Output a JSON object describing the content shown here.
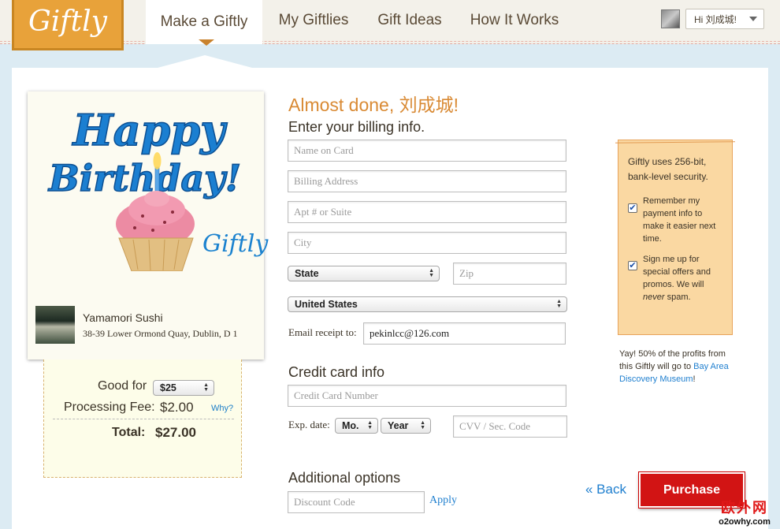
{
  "header": {
    "logo_text": "Giftly",
    "tabs": [
      {
        "label": "Make a Giftly"
      },
      {
        "label": "My Giftlies"
      },
      {
        "label": "Gift Ideas"
      },
      {
        "label": "How It Works"
      }
    ],
    "user_greeting": "Hi 刘成城!"
  },
  "card": {
    "art_text_line1": "Happy",
    "art_text_line2": "Birthday!",
    "brand": "Giftly",
    "merchant_name": "Yamamori Sushi",
    "merchant_address": "38-39 Lower Ormond Quay, Dublin, D 1"
  },
  "pricing": {
    "good_for_label": "Good for",
    "good_for_value": "$25",
    "fee_label": "Processing Fee:",
    "fee_value": "$2.00",
    "why_link": "Why?",
    "total_label": "Total:",
    "total_value": "$27.00"
  },
  "form": {
    "title": "Almost done, 刘成城!",
    "billing_heading": "Enter your billing info.",
    "name_on_card_placeholder": "Name on Card",
    "billing_address_placeholder": "Billing Address",
    "apt_placeholder": "Apt # or Suite",
    "city_placeholder": "City",
    "state_value": "State",
    "zip_placeholder": "Zip",
    "country_value": "United States",
    "email_label": "Email receipt to:",
    "email_value": "pekinlcc@126.com",
    "credit_heading": "Credit card info",
    "card_number_placeholder": "Credit Card Number",
    "exp_label": "Exp. date:",
    "month_value": "Mo.",
    "year_value": "Year",
    "cvv_placeholder": "CVV / Sec. Code",
    "additional_heading": "Additional options",
    "discount_placeholder": "Discount Code",
    "apply_label": "Apply"
  },
  "security": {
    "text": "Giftly uses 256-bit, bank-level security.",
    "remember_label": "Remember my payment info to make it easier next time.",
    "offers_label_start": "Sign me up for special offers and promos. We will ",
    "offers_label_em": "never",
    "offers_label_end": " spam.",
    "profits_text": "Yay! 50% of the profits from this Giftly will go to ",
    "profits_link": "Bay Area Discovery Museum",
    "profits_end": "!"
  },
  "actions": {
    "back_label": "« Back",
    "purchase_label": "Purchase"
  },
  "watermark": {
    "cn": "欧外网",
    "en": "o2owhy.com"
  },
  "colors": {
    "accent_orange": "#d98a34",
    "logo_bg": "#e8a23a",
    "purchase_red": "#d21414",
    "link_blue": "#1f7fcf",
    "security_bg": "#fad8a2"
  }
}
